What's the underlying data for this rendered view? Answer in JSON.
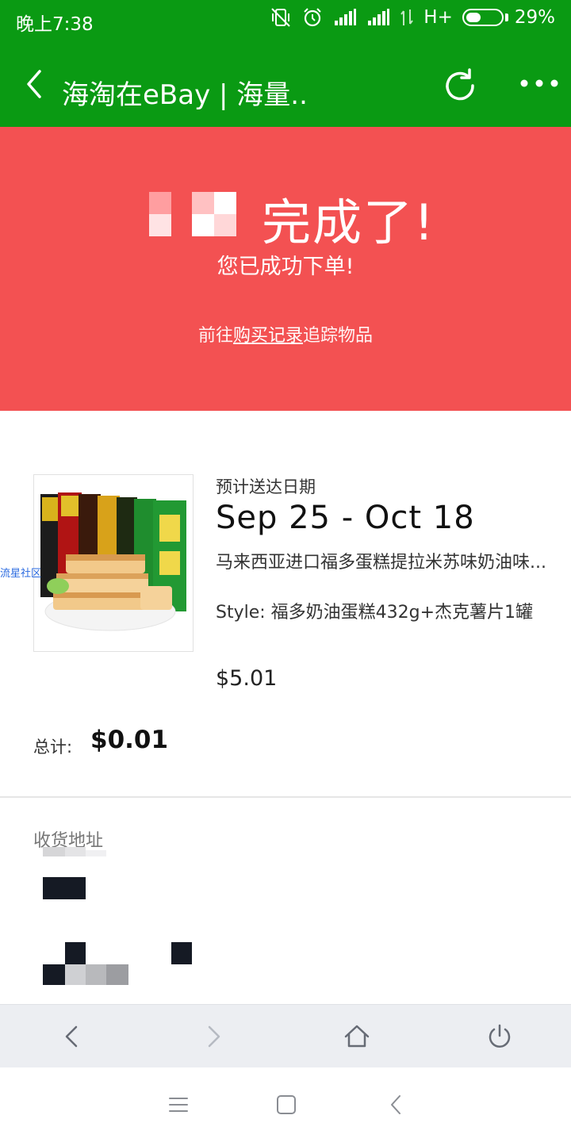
{
  "status_bar": {
    "time": "晚上7:38",
    "network": "H+",
    "battery_text": "29%",
    "battery_level": 0.29,
    "icons": [
      "vibrate-off-icon",
      "alarm-icon",
      "signal-icon",
      "signal-icon",
      "data-arrows-icon",
      "battery-icon"
    ]
  },
  "title_bar": {
    "title": "海淘在eBay | 海量..",
    "back_icon": "back-chevron-icon",
    "refresh_icon": "refresh-icon",
    "more_icon": "more-dots-icon"
  },
  "hero": {
    "title": "完成了!",
    "subtitle": "您已成功下单!",
    "link_prefix": "前往",
    "link_text": "购买记录",
    "link_suffix": "追踪物品"
  },
  "item": {
    "watermark": "流星社区",
    "delivery_label": "预计送达日期",
    "delivery_date": "Sep 25 - Oct 18",
    "title": "马来西亚进口福多蛋糕提拉米苏味奶油味...",
    "style": "Style: 福多奶油蛋糕432g+杰克薯片1罐",
    "price": "$5.01"
  },
  "total": {
    "label": "总计:",
    "value": "$0.01"
  },
  "address": {
    "label": "收货地址"
  },
  "browser_nav": {
    "icons": [
      "back-arrow-icon",
      "forward-arrow-icon",
      "home-icon",
      "power-icon"
    ]
  },
  "system_nav": {
    "icons": [
      "menu-icon",
      "square-icon",
      "back-icon"
    ]
  },
  "colors": {
    "green": "#0a9a13",
    "hero_red": "#f35152"
  }
}
